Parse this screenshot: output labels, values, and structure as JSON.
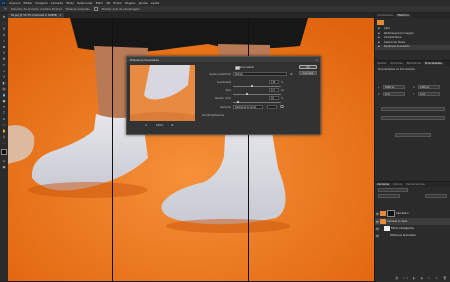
{
  "menubar": {
    "items": [
      "Arquivo",
      "Editar",
      "Imagem",
      "Camada",
      "Texto",
      "Selecionar",
      "Filtro",
      "3D",
      "Exibir",
      "Plugins",
      "Janela",
      "Ajuda"
    ]
  },
  "options": {
    "items": [
      "Tamanho da Amostra: Amostra Pontual",
      "Todas as Camadas",
      "Mostrar Anel de Amostragem"
    ]
  },
  "tabs": [
    "Pé.jpg @ 33,3% (Camada 0, RGB/8)"
  ],
  "dialog": {
    "title": "Diferença Suavizada",
    "preview_zoom": "100%",
    "personalizar_label": "Personalizar",
    "row1_label": "Ajuste predefinido",
    "row1_value": "Padrão",
    "row2_label": "Quantidade",
    "row2_value": "132",
    "row2_unit": "%",
    "row3_label": "Raio",
    "row3_value": "4,3",
    "row3_unit": "px",
    "row4_label": "Reduzir ruído",
    "row4_value": "10",
    "row4_unit": "%",
    "row5_label": "Remover",
    "row5_value": "Desfoque de lente",
    "section_label": "Sombras/Realces",
    "ok_label": "OK",
    "cancel_label": "Cancelar"
  },
  "panels": {
    "top_tabs": [
      "Comentários",
      "Histórico"
    ],
    "history": [
      "Abrir",
      "Redimensionar Imagem",
      "Camada Nova",
      "Selecionar Pixels",
      "Desfoque Suavizado"
    ],
    "prop_tabs": [
      "Ajustes",
      "Amostras",
      "Bibliotecas",
      "Propriedades"
    ],
    "prop_title": "Propriedades do Documento",
    "prop_fields": [
      "L",
      "A",
      "X",
      "Y"
    ],
    "prop_values": [
      "1000 px",
      "1000 px",
      "0 px",
      "0 px"
    ],
    "layer_tabs": [
      "Camadas",
      "Canais",
      "Demarcadores"
    ],
    "layers": [
      "Camada 1",
      "Camada 0 cópia",
      "Filtros Inteligentes",
      "Diferença Suavizada"
    ]
  },
  "colors": {
    "canvas": "#f07a1c",
    "panel": "#2b2b2b",
    "accent": "#31a8ff"
  }
}
